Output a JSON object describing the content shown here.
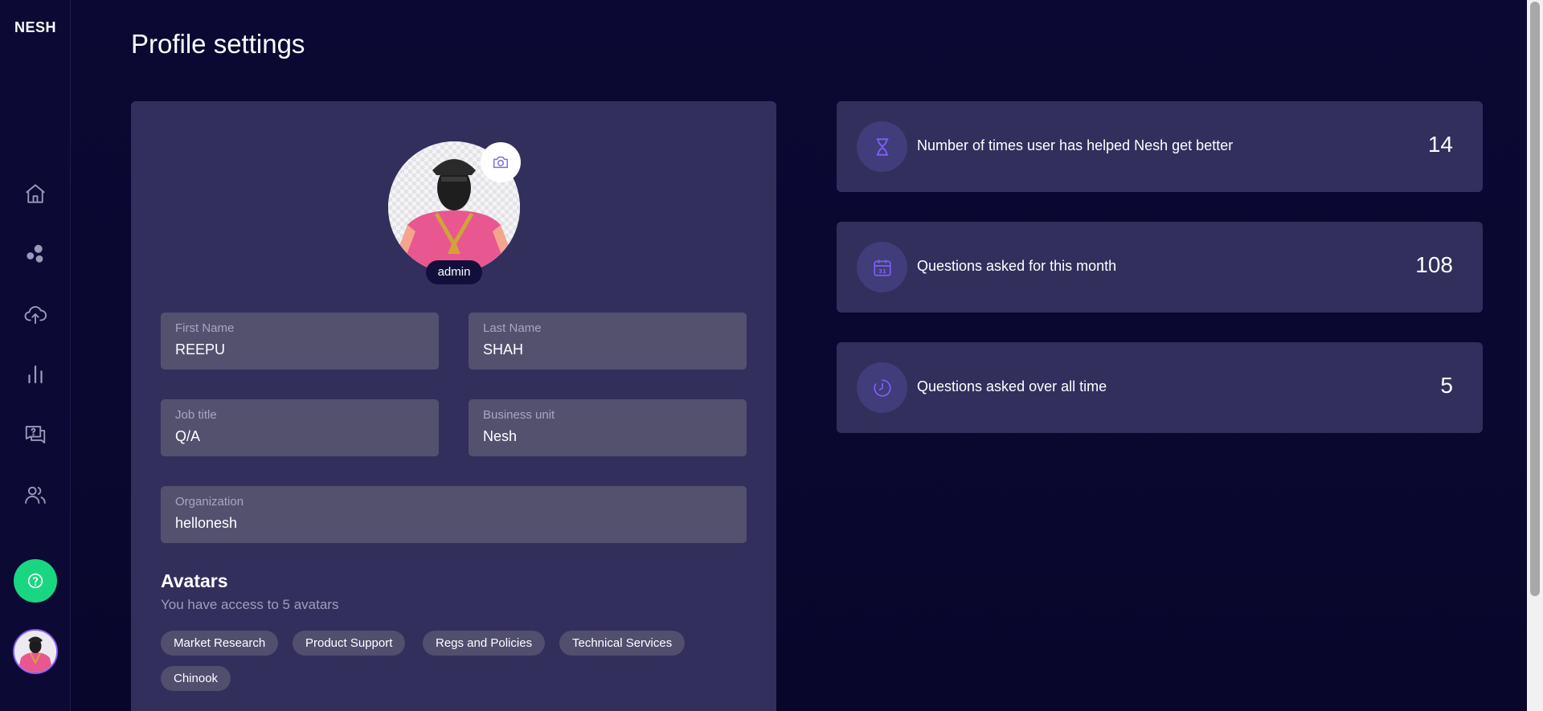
{
  "sidebar": {
    "logo": "NESH",
    "nav": [
      {
        "icon": "home-icon"
      },
      {
        "icon": "bubbles-icon"
      },
      {
        "icon": "cloud-upload-icon"
      },
      {
        "icon": "bar-chart-icon"
      },
      {
        "icon": "question-chat-icon"
      },
      {
        "icon": "users-icon"
      }
    ],
    "help_icon": "help-circle-icon"
  },
  "page": {
    "title": "Profile settings"
  },
  "profile": {
    "role_badge": "admin",
    "fields": {
      "first_name": {
        "label": "First Name",
        "value": "REEPU"
      },
      "last_name": {
        "label": "Last Name",
        "value": "SHAH"
      },
      "job_title": {
        "label": "Job title",
        "value": "Q/A"
      },
      "business_unit": {
        "label": "Business unit",
        "value": "Nesh"
      },
      "organization": {
        "label": "Organization",
        "value": "hellonesh"
      }
    },
    "avatars": {
      "heading": "Avatars",
      "subtitle": "You have access to 5 avatars",
      "chips": [
        "Market Research",
        "Product Support",
        "Regs and Policies",
        "Technical Services",
        "Chinook"
      ]
    }
  },
  "stats": [
    {
      "icon": "hourglass-icon",
      "label": "Number of times user has helped Nesh get better",
      "value": "14"
    },
    {
      "icon": "calendar-icon",
      "label": "Questions asked for this month",
      "value": "108"
    },
    {
      "icon": "clock-icon",
      "label": "Questions asked over all time",
      "value": "5"
    }
  ],
  "colors": {
    "background": "#0b0933",
    "card": "#322f5d",
    "field": "#54516f",
    "accent": "#8b5cf6",
    "help_button": "#19d780"
  }
}
